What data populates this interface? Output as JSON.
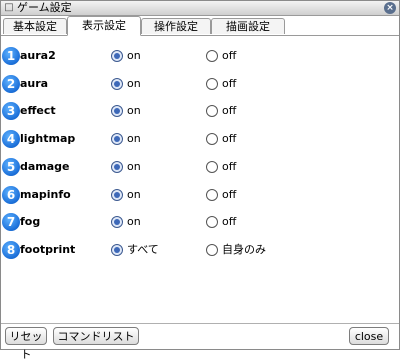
{
  "window": {
    "title": "ゲーム設定",
    "title_glyph": "□",
    "close_glyph": "×"
  },
  "tabs": [
    {
      "label": "基本設定",
      "active": false
    },
    {
      "label": "表示設定",
      "active": true
    },
    {
      "label": "操作設定",
      "active": false
    },
    {
      "label": "描画設定",
      "active": false
    }
  ],
  "options": [
    {
      "num": "1",
      "label": "aura2",
      "choice_a": "on",
      "choice_b": "off",
      "selected": "a"
    },
    {
      "num": "2",
      "label": "aura",
      "choice_a": "on",
      "choice_b": "off",
      "selected": "a"
    },
    {
      "num": "3",
      "label": "effect",
      "choice_a": "on",
      "choice_b": "off",
      "selected": "a"
    },
    {
      "num": "4",
      "label": "lightmap",
      "choice_a": "on",
      "choice_b": "off",
      "selected": "a"
    },
    {
      "num": "5",
      "label": "damage",
      "choice_a": "on",
      "choice_b": "off",
      "selected": "a"
    },
    {
      "num": "6",
      "label": "mapinfo",
      "choice_a": "on",
      "choice_b": "off",
      "selected": "a"
    },
    {
      "num": "7",
      "label": "fog",
      "choice_a": "on",
      "choice_b": "off",
      "selected": "a"
    },
    {
      "num": "8",
      "label": "footprint",
      "choice_a": "すべて",
      "choice_b": "自身のみ",
      "selected": "a"
    }
  ],
  "footer": {
    "reset_label": "リセット",
    "command_list_label": "コマンドリスト",
    "close_label": "close"
  },
  "colors": {
    "number_icon": "#1a6ed8",
    "radio_selected": "#3d68b8"
  }
}
